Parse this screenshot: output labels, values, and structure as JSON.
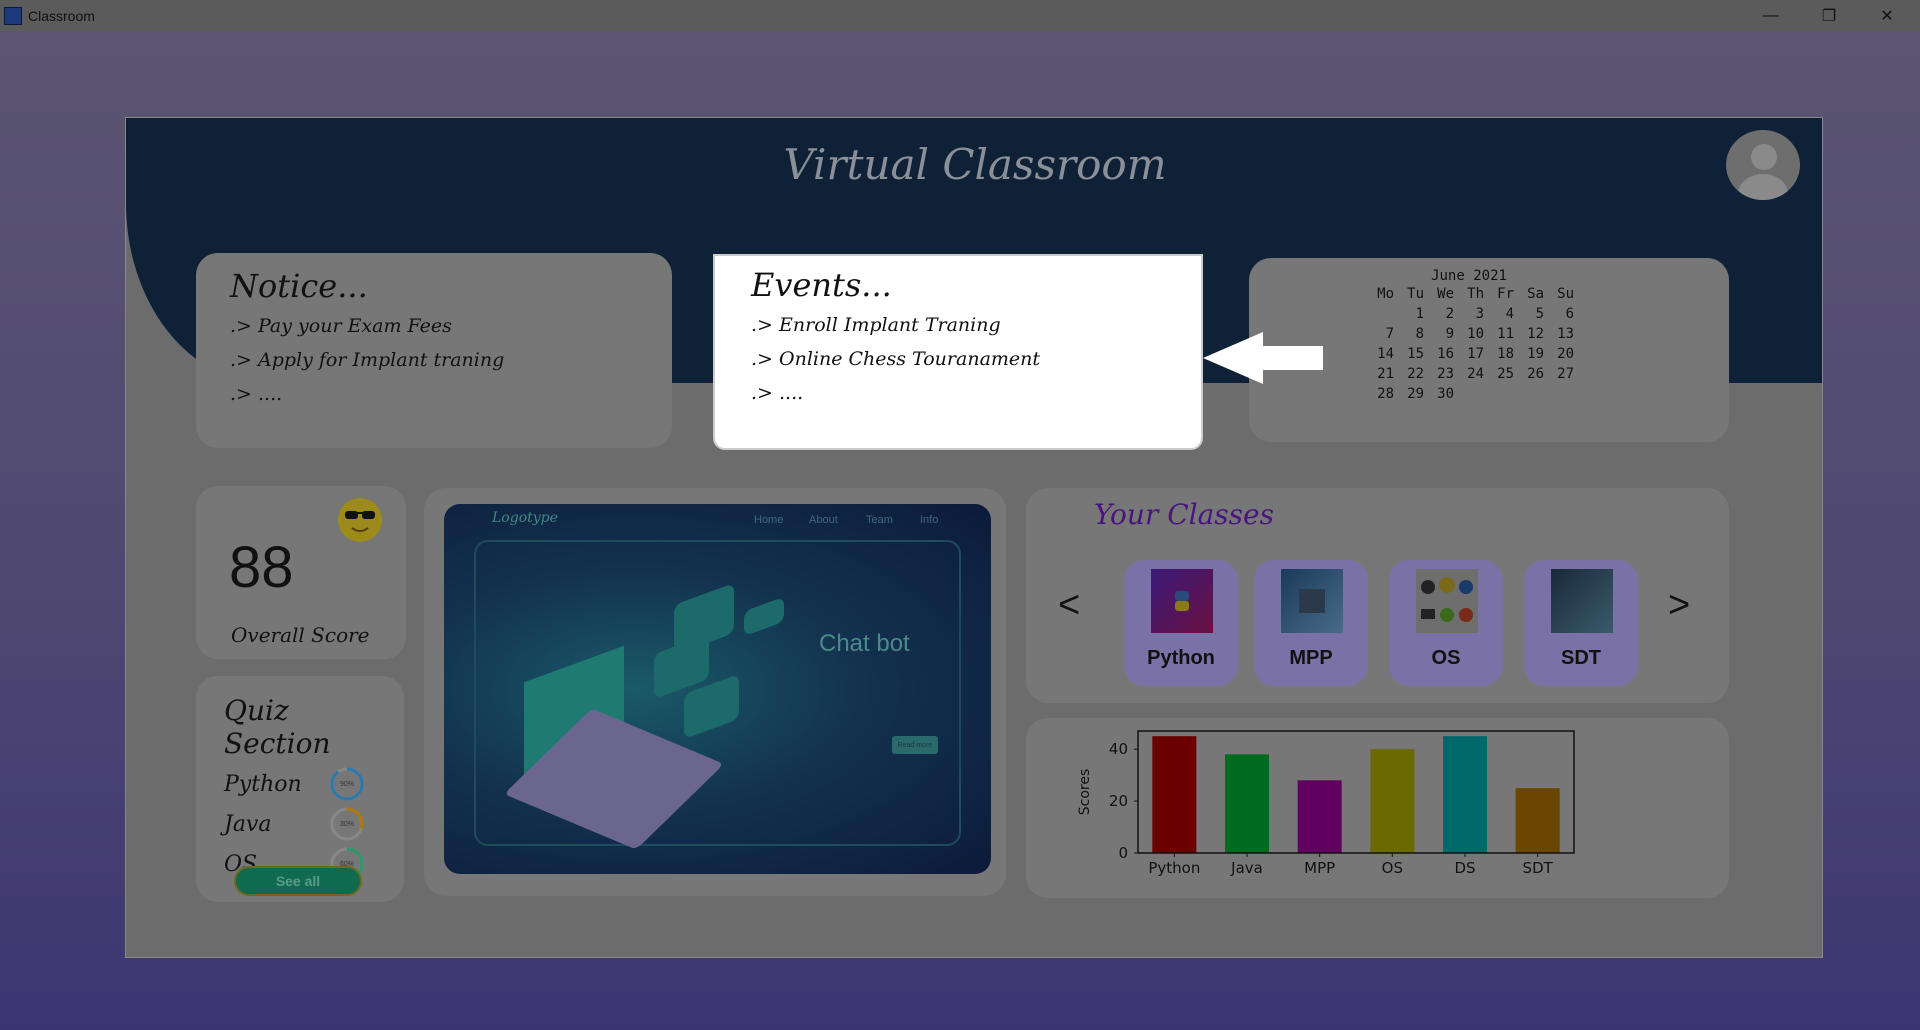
{
  "window": {
    "title": "Classroom",
    "controls": [
      "minimize",
      "restore",
      "close"
    ]
  },
  "app": {
    "title": "Virtual Classroom"
  },
  "notice": {
    "title": "Notice...",
    "items": [
      ".> Pay your Exam Fees",
      ".> Apply for Implant traning",
      ".> ...."
    ]
  },
  "events": {
    "title": "Events...",
    "items": [
      ".> Enroll Implant Traning",
      ".> Online Chess Touranament",
      ".> ...."
    ]
  },
  "calendar": {
    "caption": "June 2021",
    "weekdays": [
      "Mo",
      "Tu",
      "We",
      "Th",
      "Fr",
      "Sa",
      "Su"
    ],
    "weeks": [
      [
        "",
        "1",
        "2",
        "3",
        "4",
        "5",
        "6"
      ],
      [
        "7",
        "8",
        "9",
        "10",
        "11",
        "12",
        "13"
      ],
      [
        "14",
        "15",
        "16",
        "17",
        "18",
        "19",
        "20"
      ],
      [
        "21",
        "22",
        "23",
        "24",
        "25",
        "26",
        "27"
      ],
      [
        "28",
        "29",
        "30",
        "",
        "",
        "",
        ""
      ]
    ]
  },
  "score": {
    "value": "88",
    "label": "Overall Score",
    "icon": "sunglasses-emoji-icon"
  },
  "quiz": {
    "title": "Quiz Section",
    "items": [
      {
        "name": "Python",
        "percent": 90,
        "label": "90%",
        "color": "#2a7ab0"
      },
      {
        "name": "Java",
        "percent": 30,
        "label": "30%",
        "color": "#b0780a"
      },
      {
        "name": "OS",
        "percent": 60,
        "label": "60%",
        "color": "#2a9a6a"
      }
    ],
    "see_all": "See all"
  },
  "banner": {
    "logo": "Logotype",
    "nav": [
      "Home",
      "About",
      "Team",
      "Info"
    ],
    "headline": "Chat bot",
    "button": "Read more"
  },
  "classes": {
    "title": "Your Classes",
    "prev": "<",
    "next": ">",
    "items": [
      "Python",
      "MPP",
      "OS",
      "SDT"
    ]
  },
  "chart_data": {
    "type": "bar",
    "categories": [
      "Python",
      "Java",
      "MPP",
      "OS",
      "DS",
      "SDT"
    ],
    "values": [
      45,
      38,
      28,
      40,
      45,
      25
    ],
    "colors": [
      "#6a0000",
      "#006a1e",
      "#620062",
      "#6a6a00",
      "#006a6a",
      "#6a4600"
    ],
    "ylabel": "Scores",
    "xlabel": "",
    "ylim": [
      0,
      47
    ],
    "yticks": [
      0,
      20,
      40
    ],
    "grid": false
  }
}
